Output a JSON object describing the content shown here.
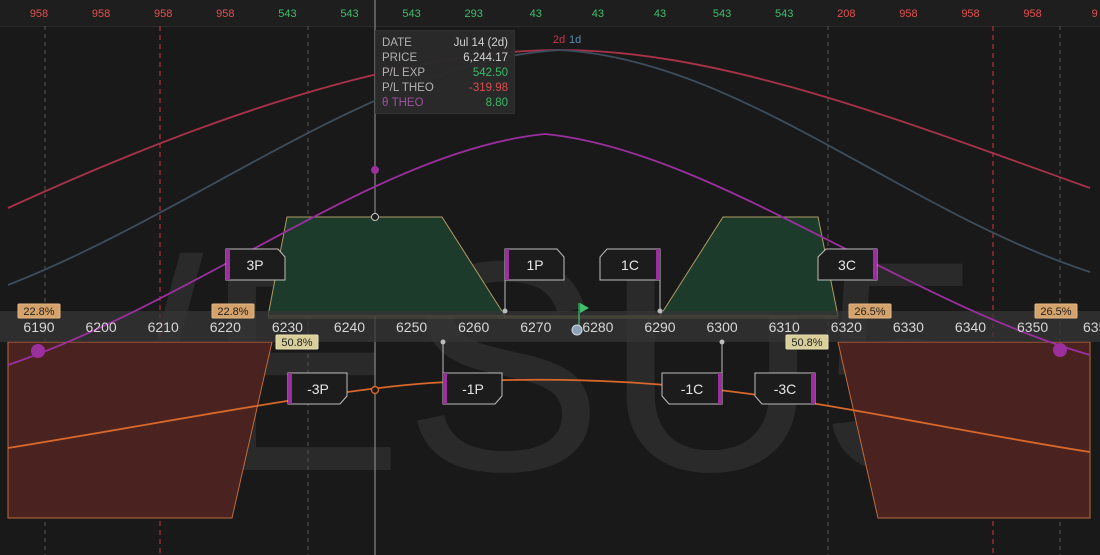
{
  "watermark": "/ESU5",
  "top_counts": [
    {
      "text": "958",
      "color": "#e2504f"
    },
    {
      "text": "958",
      "color": "#e2504f"
    },
    {
      "text": "958",
      "color": "#e2504f"
    },
    {
      "text": "958",
      "color": "#e2504f"
    },
    {
      "text": "543",
      "color": "#3fbf6a"
    },
    {
      "text": "543",
      "color": "#3fbf6a"
    },
    {
      "text": "543",
      "color": "#3fbf6a"
    },
    {
      "text": "293",
      "color": "#3fbf6a"
    },
    {
      "text": "43",
      "color": "#3fbf6a"
    },
    {
      "text": "43",
      "color": "#3fbf6a"
    },
    {
      "text": "43",
      "color": "#3fbf6a"
    },
    {
      "text": "543",
      "color": "#3fbf6a"
    },
    {
      "text": "543",
      "color": "#3fbf6a"
    },
    {
      "text": "208",
      "color": "#e2504f"
    },
    {
      "text": "958",
      "color": "#e2504f"
    },
    {
      "text": "958",
      "color": "#e2504f"
    },
    {
      "text": "958",
      "color": "#e2504f"
    },
    {
      "text": "9",
      "color": "#e2504f"
    }
  ],
  "tooltip": {
    "date_label": "DATE",
    "date_value": "Jul 14 (2d)",
    "price_label": "PRICE",
    "price_value": "6,244.17",
    "plexp_label": "P/L EXP",
    "plexp_value": "542.50",
    "pltheo_label": "P/L THEO",
    "pltheo_value": "-319.98",
    "theta_label": "θ THEO",
    "theta_value": "8.80"
  },
  "legend": {
    "item1": "2d",
    "item2": "1d"
  },
  "price_ticks": [
    "6190",
    "6200",
    "6210",
    "6220",
    "6230",
    "6240",
    "6250",
    "6260",
    "6270",
    "6280",
    "6290",
    "6300",
    "6310",
    "6320",
    "6330",
    "6340",
    "6350",
    "635"
  ],
  "probabilities": {
    "top_left": "22.8%",
    "top_mid_left": "22.8%",
    "bottom_mid_left": "50.8%",
    "bottom_mid_right": "50.8%",
    "top_mid_right": "26.5%",
    "top_right": "26.5%"
  },
  "strikes": {
    "long_put_far": "3P",
    "long_put_near": "1P",
    "long_call_near": "1C",
    "long_call_far": "3C",
    "short_put_far": "-3P",
    "short_put_near": "-1P",
    "short_call_near": "-1C",
    "short_call_far": "-3C"
  },
  "colors": {
    "profit_fill": "#1d3b2a",
    "loss_fill": "#4a2320",
    "curve_2d": "#a8324a",
    "curve_1d": "#3c4d5c",
    "theta_curve": "#9b2f9e",
    "delta_curve": "#d7672a",
    "accent_green": "#3fbf6a",
    "accent_red": "#e2504f"
  }
}
